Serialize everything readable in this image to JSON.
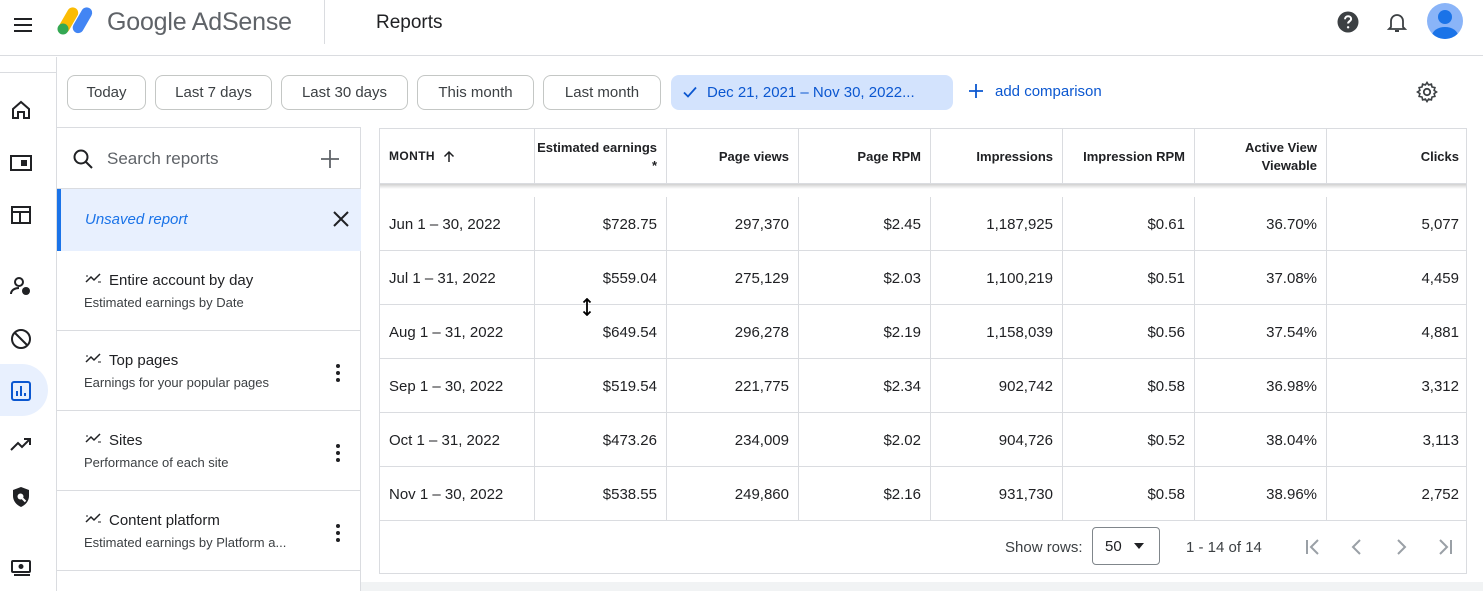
{
  "app": {
    "name": "Google AdSense",
    "page_title": "Reports"
  },
  "filters": {
    "chips": [
      "Today",
      "Last 7 days",
      "Last 30 days",
      "This month",
      "Last month"
    ],
    "active_range": "Dec 21, 2021 – Nov 30, 2022...",
    "add_comparison": "add comparison"
  },
  "panel": {
    "search_placeholder": "Search reports",
    "unsaved": "Unsaved report",
    "reports": [
      {
        "title": "Entire account by day",
        "subtitle": "Estimated earnings by Date",
        "has_menu": false
      },
      {
        "title": "Top pages",
        "subtitle": "Earnings for your popular pages",
        "has_menu": true
      },
      {
        "title": "Sites",
        "subtitle": "Performance of each site",
        "has_menu": true
      },
      {
        "title": "Content platform",
        "subtitle": "Estimated earnings by Platform a...",
        "has_menu": true
      }
    ]
  },
  "table": {
    "columns": [
      {
        "label": "MONTH",
        "sorted": "asc"
      },
      {
        "label": "Estimated earnings *"
      },
      {
        "label": "Page views"
      },
      {
        "label": "Page RPM"
      },
      {
        "label": "Impressions"
      },
      {
        "label": "Impression RPM"
      },
      {
        "label": "Active View Viewable"
      },
      {
        "label": "Clicks"
      }
    ],
    "rows": [
      [
        "Jun 1 – 30, 2022",
        "$728.75",
        "297,370",
        "$2.45",
        "1,187,925",
        "$0.61",
        "36.70%",
        "5,077"
      ],
      [
        "Jul 1 – 31, 2022",
        "$559.04",
        "275,129",
        "$2.03",
        "1,100,219",
        "$0.51",
        "37.08%",
        "4,459"
      ],
      [
        "Aug 1 – 31, 2022",
        "$649.54",
        "296,278",
        "$2.19",
        "1,158,039",
        "$0.56",
        "37.54%",
        "4,881"
      ],
      [
        "Sep 1 – 30, 2022",
        "$519.54",
        "221,775",
        "$2.34",
        "902,742",
        "$0.58",
        "36.98%",
        "3,312"
      ],
      [
        "Oct 1 – 31, 2022",
        "$473.26",
        "234,009",
        "$2.02",
        "904,726",
        "$0.52",
        "38.04%",
        "3,113"
      ],
      [
        "Nov 1 – 30, 2022",
        "$538.55",
        "249,860",
        "$2.16",
        "931,730",
        "$0.58",
        "38.96%",
        "2,752"
      ]
    ],
    "footer": {
      "show_rows_label": "Show rows:",
      "rows_value": "50",
      "range_text": "1 - 14 of 14"
    }
  },
  "colors": {
    "accent": "#1a73e8",
    "active_chip": "#d3e3fd",
    "selected_bg": "#e8f0fe"
  }
}
